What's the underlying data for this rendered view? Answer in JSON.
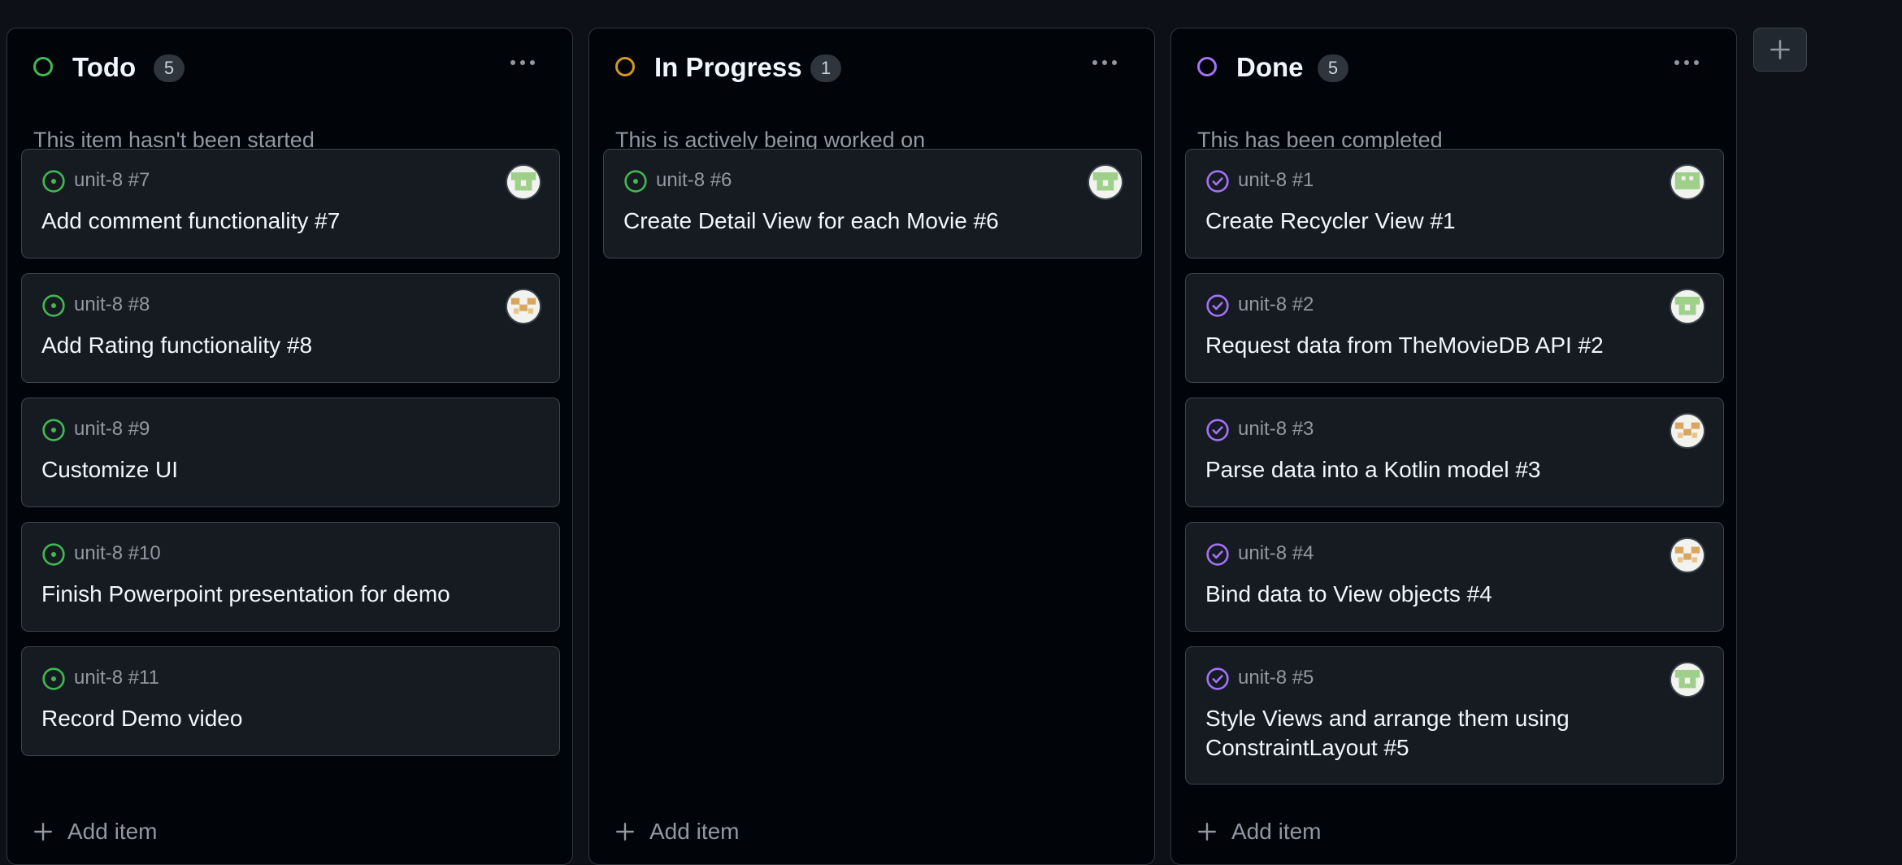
{
  "board": {
    "columns": [
      {
        "key": "todo",
        "title": "Todo",
        "count": "5",
        "description": "This item hasn't been started",
        "status_color": "#3fb950",
        "add_label": "Add item",
        "cards": [
          {
            "ref": "unit-8 #7",
            "title": "Add comment functionality #7",
            "state": "open",
            "avatar": "green-pixel-avatar"
          },
          {
            "ref": "unit-8 #8",
            "title": "Add Rating functionality #8",
            "state": "open",
            "avatar": "orange-pixel-avatar"
          },
          {
            "ref": "unit-8 #9",
            "title": "Customize UI",
            "state": "open",
            "avatar": ""
          },
          {
            "ref": "unit-8 #10",
            "title": "Finish Powerpoint presentation for demo",
            "state": "open",
            "avatar": ""
          },
          {
            "ref": "unit-8 #11",
            "title": "Record Demo video",
            "state": "open",
            "avatar": ""
          }
        ]
      },
      {
        "key": "in-progress",
        "title": "In Progress",
        "count": "1",
        "description": "This is actively being worked on",
        "status_color": "#d29922",
        "add_label": "Add item",
        "cards": [
          {
            "ref": "unit-8 #6",
            "title": "Create Detail View for each Movie #6",
            "state": "open",
            "avatar": "green-pixel-avatar"
          }
        ]
      },
      {
        "key": "done",
        "title": "Done",
        "count": "5",
        "description": "This has been completed",
        "status_color": "#a371f7",
        "add_label": "Add item",
        "cards": [
          {
            "ref": "unit-8 #1",
            "title": "Create Recycler View #1",
            "state": "closed",
            "avatar": "green-pixel-avatar"
          },
          {
            "ref": "unit-8 #2",
            "title": "Request data from TheMovieDB API #2",
            "state": "closed",
            "avatar": "green-pixel-avatar"
          },
          {
            "ref": "unit-8 #3",
            "title": "Parse data into a Kotlin model #3",
            "state": "closed",
            "avatar": "orange-pixel-avatar"
          },
          {
            "ref": "unit-8 #4",
            "title": "Bind data to View objects #4",
            "state": "closed",
            "avatar": "orange-pixel-avatar"
          },
          {
            "ref": "unit-8 #5",
            "title": "Style Views and arrange them using ConstraintLayout #5",
            "state": "closed",
            "avatar": "green-pixel-avatar"
          }
        ]
      }
    ],
    "icons": {
      "open_issue": "issue-open-icon",
      "closed_issue": "issue-closed-icon",
      "add": "plus-icon",
      "menu": "kebab-menu-icon"
    },
    "colors": {
      "background": "#0d1117",
      "column_bg": "#010409",
      "card_bg": "#161b22",
      "border": "#30363d",
      "open_icon": "#3fb950",
      "closed_icon": "#a371f7",
      "muted_text": "#9198a1"
    }
  }
}
